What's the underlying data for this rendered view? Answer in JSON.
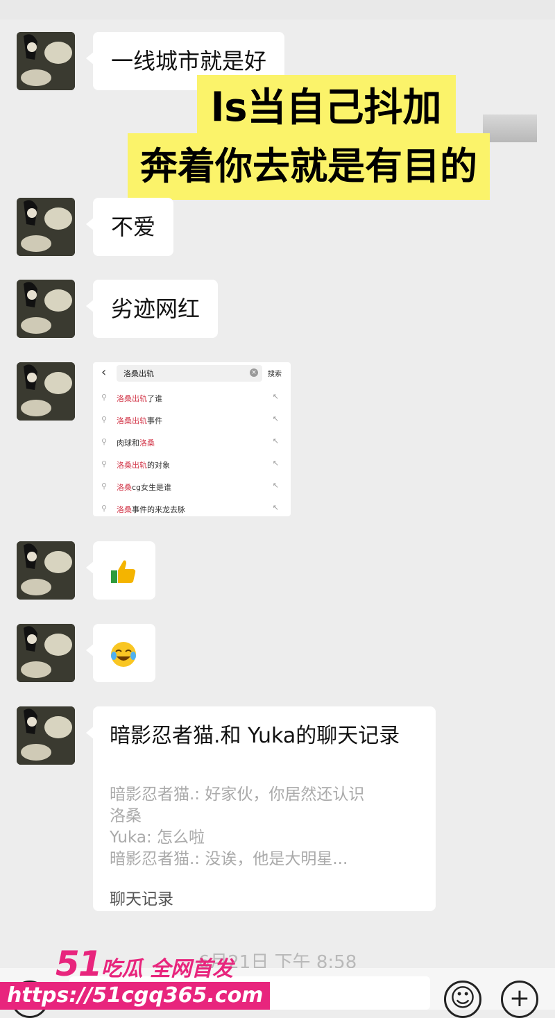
{
  "messages": [
    {
      "text": "一线城市就是好"
    },
    {
      "text": "不爱"
    },
    {
      "text": "劣迹网红"
    }
  ],
  "caption": {
    "line1": "ls当自己抖加",
    "line2": "奔着你去就是有目的"
  },
  "search_shot": {
    "query": "洛桑出轨",
    "search_label": "搜索",
    "suggestions": [
      {
        "red": "洛桑出轨",
        "rest": "了谁"
      },
      {
        "red": "洛桑出轨",
        "rest": "事件"
      },
      {
        "pre": "肉球和",
        "red": "洛桑",
        "rest": ""
      },
      {
        "red": "洛桑出轨",
        "rest": "的对象"
      },
      {
        "red": "洛桑",
        "rest": "cg女生是谁"
      },
      {
        "red": "洛桑",
        "rest": "事件的来龙去脉"
      }
    ]
  },
  "emoji_messages": [
    {
      "icon": "thumbs-up-icon"
    },
    {
      "icon": "crying-laughing-icon"
    }
  ],
  "chat_record": {
    "title": "暗影忍者猫.和 Yuka的聊天记录",
    "lines": [
      "暗影忍者猫.: 好家伙，你居然还认识",
      "洛桑",
      "Yuka: 怎么啦",
      "暗影忍者猫.: 没诶，他是大明星..."
    ],
    "footer": "聊天记录"
  },
  "timestamp": "6月21日 下午 8:58",
  "watermark": {
    "brand_num": "51",
    "brand_text": "吃瓜 全网首发",
    "url": "https://51cgq365.com"
  }
}
